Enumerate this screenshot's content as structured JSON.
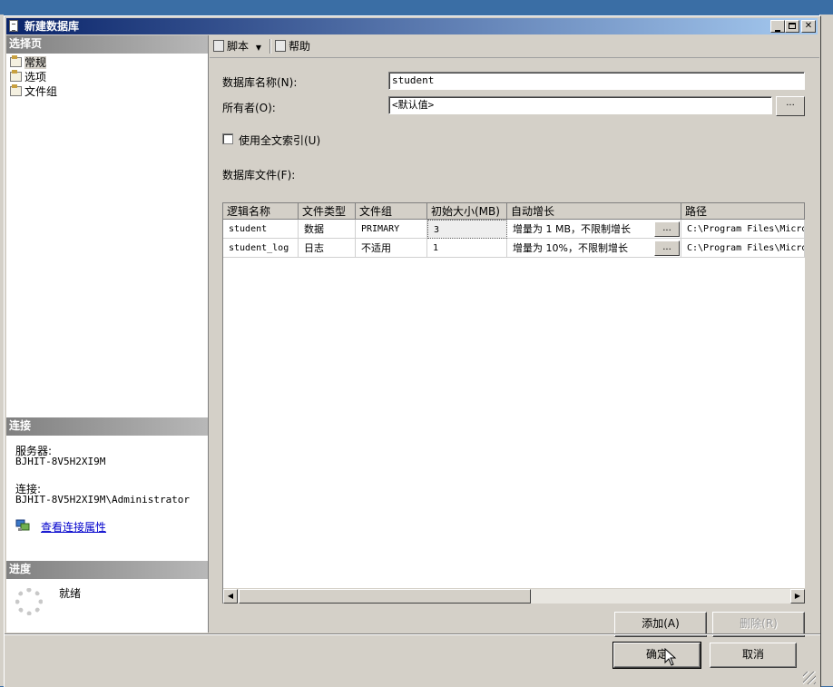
{
  "window": {
    "title": "新建数据库"
  },
  "left_pane": {
    "select_page_header": "选择页",
    "pages": [
      {
        "label": "常规",
        "selected": true
      },
      {
        "label": "选项",
        "selected": false
      },
      {
        "label": "文件组",
        "selected": false
      }
    ],
    "connection_header": "连接",
    "server_label": "服务器:",
    "server_value": "BJHIT-8V5H2XI9M",
    "connection_label": "连接:",
    "connection_value": "BJHIT-8V5H2XI9M\\Administrator",
    "view_connection_link": "查看连接属性",
    "progress_header": "进度",
    "progress_status": "就绪"
  },
  "toolbar": {
    "script_label": "脚本",
    "help_label": "帮助"
  },
  "form": {
    "db_name_label": "数据库名称(N):",
    "db_name_value": "student",
    "owner_label": "所有者(O):",
    "owner_value": "<默认值>",
    "browse_label": "...",
    "fulltext_label": "使用全文索引(U)",
    "fulltext_checked": false,
    "files_label": "数据库文件(F):"
  },
  "files_table": {
    "columns": [
      "逻辑名称",
      "文件类型",
      "文件组",
      "初始大小(MB)",
      "自动增长",
      "路径"
    ],
    "rows": [
      {
        "logical_name": "student",
        "file_type": "数据",
        "filegroup": "PRIMARY",
        "initial_size": "3",
        "autogrowth": "增量为 1 MB，不限制增长",
        "path": "C:\\Program Files\\Micro"
      },
      {
        "logical_name": "student_log",
        "file_type": "日志",
        "filegroup": "不适用",
        "initial_size": "1",
        "autogrowth": "增量为 10%，不限制增长",
        "path": "C:\\Program Files\\Micro"
      }
    ],
    "cell_button_label": "..."
  },
  "buttons": {
    "add": "添加(A)",
    "remove": "删除(R)",
    "ok": "确定",
    "cancel": "取消"
  }
}
